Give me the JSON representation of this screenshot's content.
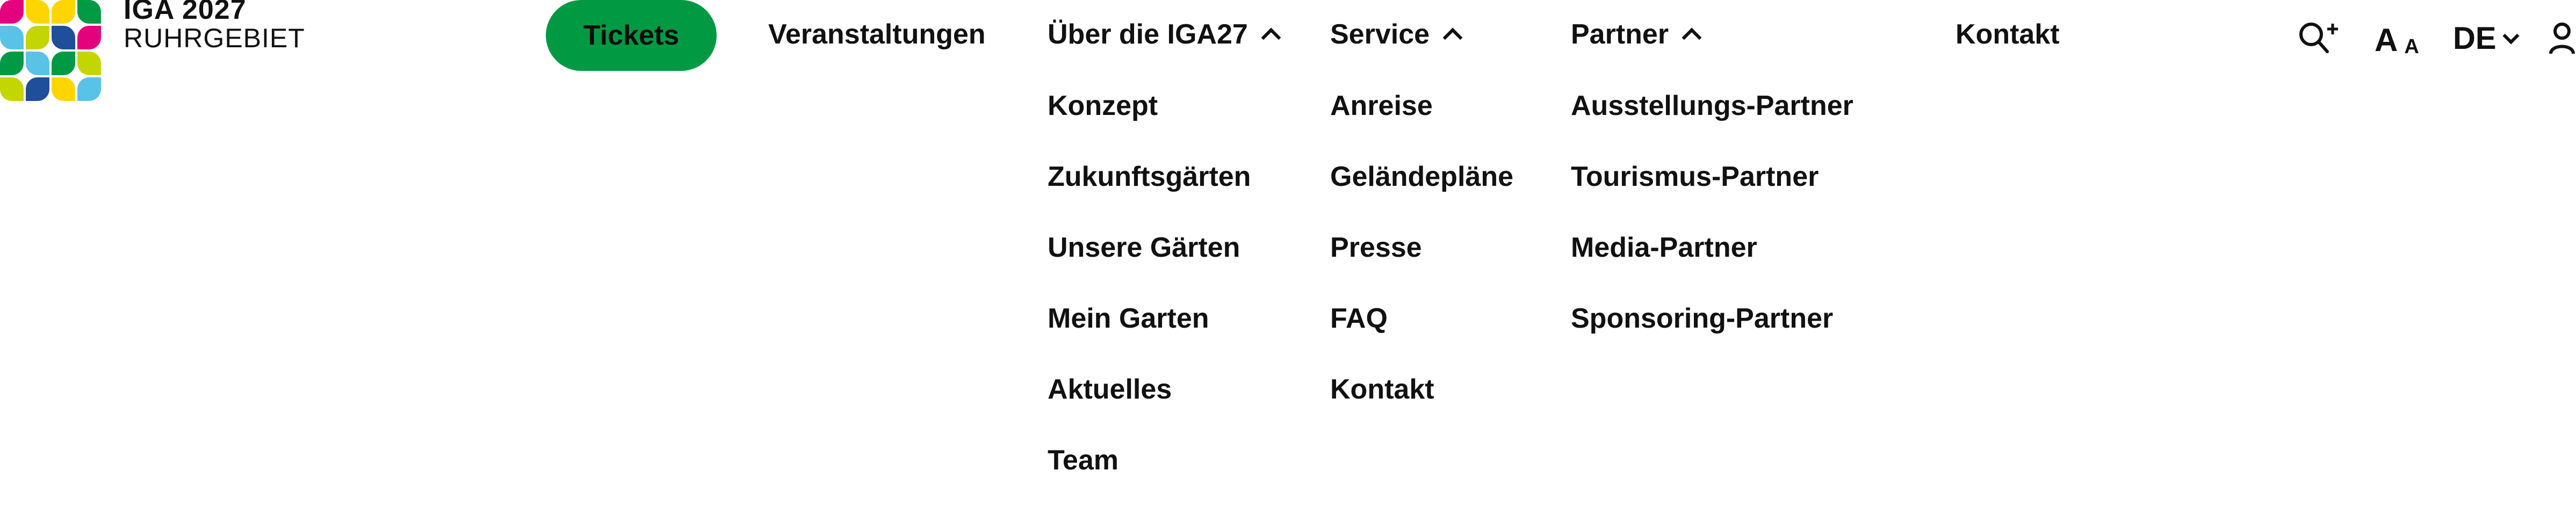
{
  "brand": {
    "line1": "IGA 2027",
    "line2": "RUHRGEBIET"
  },
  "logo_colors": [
    "#e5007e",
    "#ffd500",
    "#ffd500",
    "#009a44",
    "#59c2e7",
    "#c4d600",
    "#1f4e9b",
    "#e5007e",
    "#009a44",
    "#59c2e7",
    "#009a44",
    "#c4d600",
    "#c4d600",
    "#1f4e9b",
    "#ffd500",
    "#59c2e7"
  ],
  "accent_color": "#029943",
  "nav": {
    "tickets": "Tickets",
    "veranstaltungen": "Veranstaltungen",
    "ueber": "Über die IGA27",
    "service": "Service",
    "partner": "Partner",
    "kontakt": "Kontakt"
  },
  "submenus": {
    "ueber": [
      "Konzept",
      "Zukunftsgärten",
      "Unsere Gärten",
      "Mein Garten",
      "Aktuelles",
      "Team"
    ],
    "service": [
      "Anreise",
      "Geländepläne",
      "Presse",
      "FAQ",
      "Kontakt"
    ],
    "partner": [
      "Ausstellungs-Partner",
      "Tourismus-Partner",
      "Media-Partner",
      "Sponsoring-Partner"
    ]
  },
  "tools": {
    "search_icon": "search-plus-icon",
    "font_big": "A",
    "font_small": "A",
    "language": "DE",
    "account_icon": "user-icon"
  }
}
